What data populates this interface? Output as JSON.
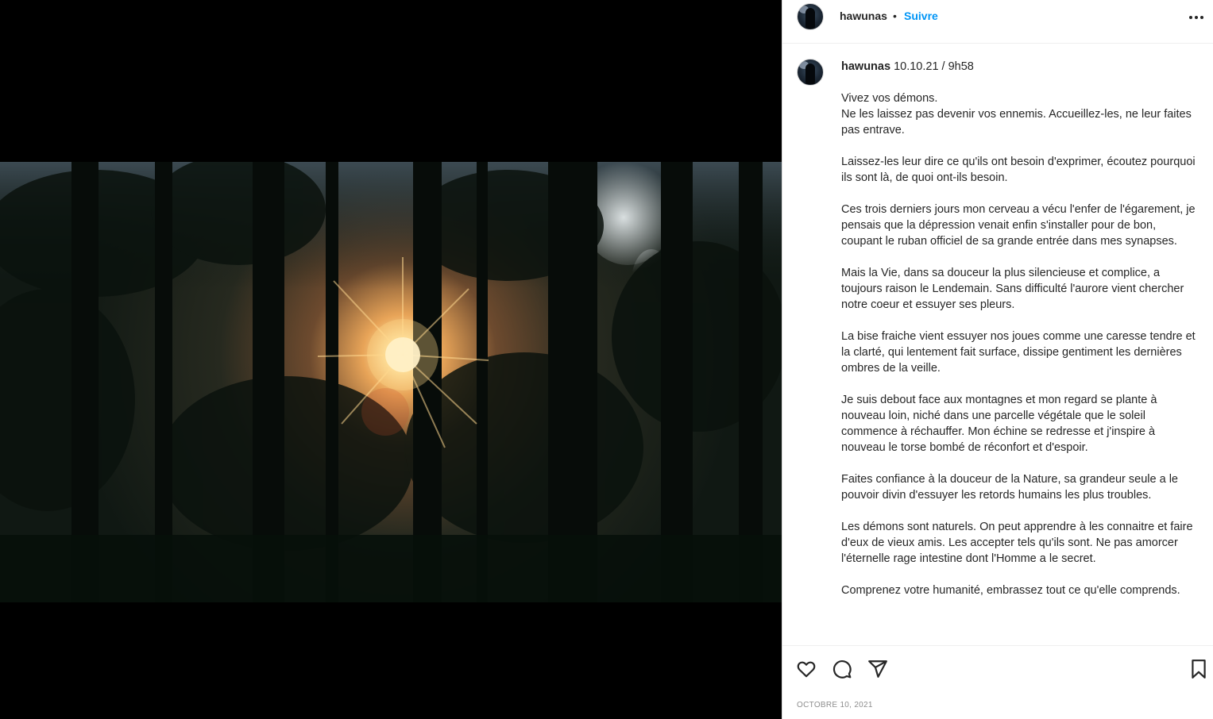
{
  "post": {
    "username": "hawunas",
    "separator": "•",
    "follow_label": "Suivre",
    "image_alt": "sunset-through-forest-photo"
  },
  "caption": {
    "username": "hawunas",
    "timestamp": "10.10.21 / 9h58",
    "text": "Vivez vos démons.\nNe les laissez pas devenir vos ennemis. Accueillez-les, ne leur faites pas entrave.\n\nLaissez-les leur dire ce qu'ils ont besoin d'exprimer, écoutez pourquoi ils sont là, de quoi ont-ils besoin.\n\nCes trois derniers jours mon cerveau a vécu l'enfer de l'égarement, je pensais que la dépression venait enfin s'installer pour de bon, coupant le ruban officiel de sa grande entrée dans mes synapses.\n\nMais la Vie, dans sa douceur la plus silencieuse et complice, a toujours raison le Lendemain. Sans difficulté l'aurore vient chercher notre coeur et essuyer ses pleurs.\n\nLa bise fraiche vient essuyer nos joues comme une caresse tendre et la clarté, qui lentement fait surface, dissipe gentiment les dernières ombres de la veille.\n\nJe suis debout face aux montagnes et mon regard se plante à nouveau loin, niché dans une parcelle végétale que le soleil commence à réchauffer. Mon échine se redresse et j'inspire à nouveau le torse bombé de réconfort et d'espoir.\n\nFaites confiance à la douceur de la Nature, sa grandeur seule a le pouvoir divin d'essuyer les retords humains les plus troubles.\n\nLes démons sont naturels. On peut apprendre à les connaitre et faire d'eux de vieux amis. Les accepter tels qu'ils sont. Ne pas amorcer l'éternelle rage intestine dont l'Homme a le secret.\n\nComprenez votre humanité, embrassez tout ce qu'elle comprends."
  },
  "actions": {
    "like_icon": "heart-icon",
    "comment_icon": "comment-icon",
    "share_icon": "share-icon",
    "save_icon": "bookmark-icon"
  },
  "date_label": "OCTOBRE 10, 2021",
  "colors": {
    "accent": "#0095f6",
    "text": "#262626",
    "muted": "#8e8e8e",
    "border": "#dbdbdb"
  }
}
